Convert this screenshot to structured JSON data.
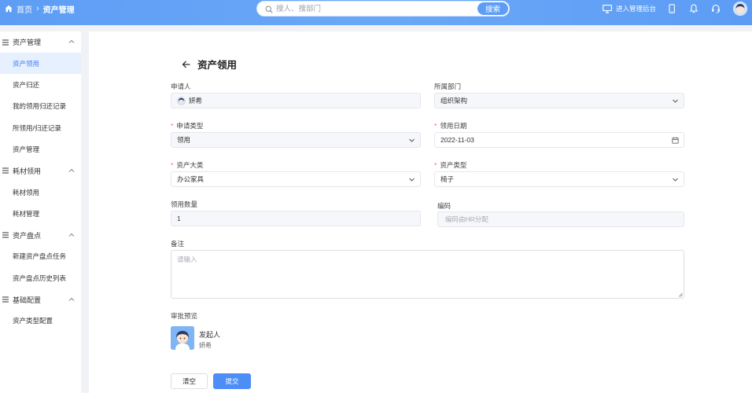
{
  "header": {
    "breadcrumb_home": "首页",
    "breadcrumb_current": "资产管理",
    "search_placeholder": "搜人、搜部门",
    "search_button": "搜索",
    "admin_link": "进入管理后台",
    "icons": [
      "home-icon",
      "search-icon",
      "monitor-icon",
      "tablet-icon",
      "bell-icon",
      "headset-icon"
    ]
  },
  "sidebar": {
    "groups": [
      {
        "label": "资产管理",
        "items": [
          "资产领用",
          "资产归还",
          "我的领用归还记录",
          "所领用/归还记录",
          "资产管理"
        ]
      },
      {
        "label": "耗材领用",
        "items": [
          "耗材领用",
          "耗材管理"
        ]
      },
      {
        "label": "资产盘点",
        "items": [
          "新建资产盘点任务",
          "资产盘点历史列表"
        ]
      },
      {
        "label": "基础配置",
        "items": [
          "资产类型配置"
        ]
      }
    ],
    "active_item": "资产领用"
  },
  "form": {
    "title": "资产领用",
    "applicant_label": "申请人",
    "applicant_value": "妍希",
    "dept_label": "所属部门",
    "dept_value": "组织架构",
    "apply_type_label": "申请类型",
    "apply_type_value": "领用",
    "date_label": "领用日期",
    "date_value": "2022-11-03",
    "asset_category_label": "资产大类",
    "asset_category_value": "办公家具",
    "asset_type_label": "资产类型",
    "asset_type_value": "椅子",
    "qty_label": "领用数量",
    "qty_value": "1",
    "code_label": "编码",
    "code_placeholder": "编码由HR分配",
    "remark_label": "备注",
    "remark_placeholder": "请输入",
    "approval_label": "审批预览",
    "approver_role": "发起人",
    "approver_name": "妍希",
    "clear_button": "清空",
    "submit_button": "提交"
  },
  "colors": {
    "primary": "#4c8df6",
    "header": "#5d9df5",
    "required": "#f56c6c"
  }
}
